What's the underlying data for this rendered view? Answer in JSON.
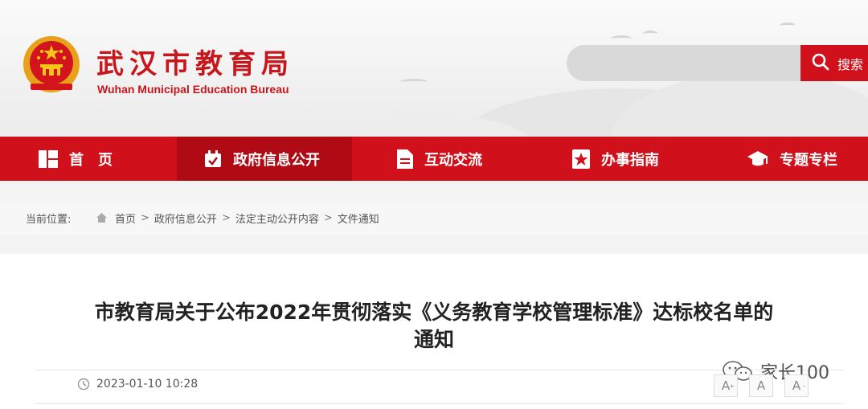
{
  "header": {
    "title_cn": "武汉市教育局",
    "title_en": "Wuhan Municipal Education Bureau",
    "emblem_icon": "national-emblem-icon",
    "search": {
      "placeholder": "",
      "button_label": "搜索",
      "icon": "search-icon"
    }
  },
  "nav": {
    "items": [
      {
        "label": "首　页",
        "icon": "home-grid-icon"
      },
      {
        "label": "政府信息公开",
        "icon": "calendar-check-icon",
        "active": true
      },
      {
        "label": "互动交流",
        "icon": "document-icon"
      },
      {
        "label": "办事指南",
        "icon": "star-badge-icon"
      },
      {
        "label": "专题专栏",
        "icon": "mortarboard-icon"
      }
    ]
  },
  "breadcrumb": {
    "label": "当前位置:",
    "items": [
      "首页",
      "政府信息公开",
      "法定主动公开内容",
      "文件通知"
    ],
    "separator": ">"
  },
  "article": {
    "title_line1": "市教育局关于公布2022年贯彻落实《义务教育学校管理标准》达标校名单的",
    "title_line2": "通知",
    "date": "2023-01-10 10:28"
  },
  "font_size_buttons": [
    "A",
    "A",
    "A"
  ],
  "font_size_marks": [
    "+",
    "",
    "-"
  ],
  "watermark": {
    "text": "家长100"
  },
  "colors": {
    "brand_red": "#d0101b",
    "nav_active": "#b00a14",
    "title_red": "#c8161d"
  }
}
